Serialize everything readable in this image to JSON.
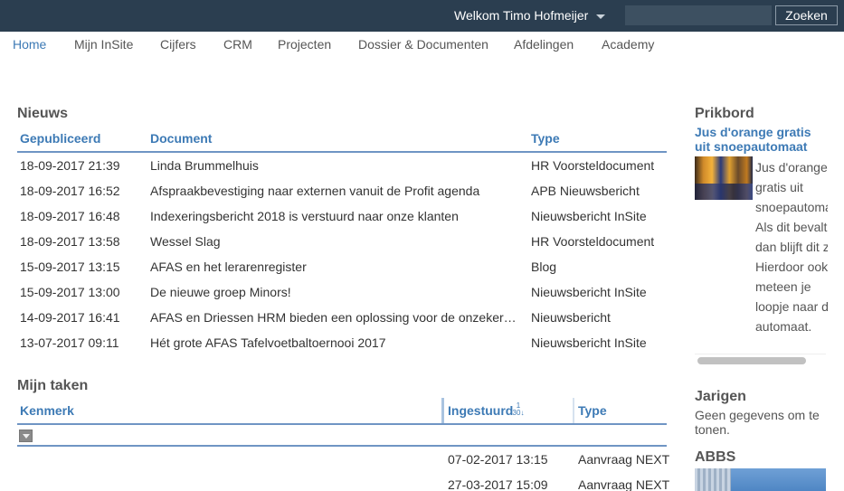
{
  "header": {
    "welcome": "Welkom Timo Hofmeijer",
    "search_placeholder": "",
    "search_button": "Zoeken"
  },
  "nav": {
    "items": [
      "Home",
      "Mijn InSite",
      "Cijfers",
      "CRM",
      "Projecten",
      "Dossier & Documenten",
      "Afdelingen",
      "Academy"
    ],
    "active": "Home"
  },
  "nieuws": {
    "title": "Nieuws",
    "columns": [
      "Gepubliceerd",
      "Document",
      "Type"
    ],
    "rows": [
      [
        "18-09-2017 21:39",
        "Linda Brummelhuis",
        "HR Voorsteldocument"
      ],
      [
        "18-09-2017 16:52",
        "Afspraakbevestiging naar externen vanuit de Profit agenda",
        "APB Nieuwsbericht"
      ],
      [
        "18-09-2017 16:48",
        "Indexeringsbericht 2018 is verstuurd naar onze klanten",
        "Nieuwsbericht InSite"
      ],
      [
        "18-09-2017 13:58",
        "Wessel Slag",
        "HR Voorsteldocument"
      ],
      [
        "15-09-2017 13:15",
        "AFAS en het lerarenregister",
        "Blog"
      ],
      [
        "15-09-2017 13:00",
        "De nieuwe groep Minors!",
        "Nieuwsbericht InSite"
      ],
      [
        "14-09-2017 16:41",
        "AFAS en Driessen HRM bieden een oplossing voor de onzekerheid rond...",
        "Nieuwsbericht"
      ],
      [
        "13-07-2017 09:11",
        "Hét grote AFAS Tafelvoetbaltoernooi 2017",
        "Nieuwsbericht InSite"
      ]
    ]
  },
  "taken": {
    "title": "Mijn taken",
    "columns": [
      "Kenmerk",
      "Ingestuurd",
      "Type"
    ],
    "sort_icon": "sort-numeric-ascending-icon",
    "rows": [
      [
        "",
        "07-02-2017 13:15",
        "Aanvraag NEXT"
      ],
      [
        "",
        "27-03-2017 15:09",
        "Aanvraag NEXT"
      ]
    ]
  },
  "prikbord": {
    "title": "Prikbord",
    "item_title": "Jus d'orange gratis uit snoepautomaat",
    "item_lines": [
      "Jus d'orange",
      "gratis uit",
      "snoepautomaat.",
      "Als dit bevalt,",
      "dan blijft dit zo.",
      "Hierdoor ook",
      "meteen je",
      "loopje naar de",
      "automaat."
    ]
  },
  "jarigen": {
    "title": "Jarigen",
    "text": "Geen gegevens om te tonen."
  },
  "abbs": {
    "title": "ABBS"
  }
}
